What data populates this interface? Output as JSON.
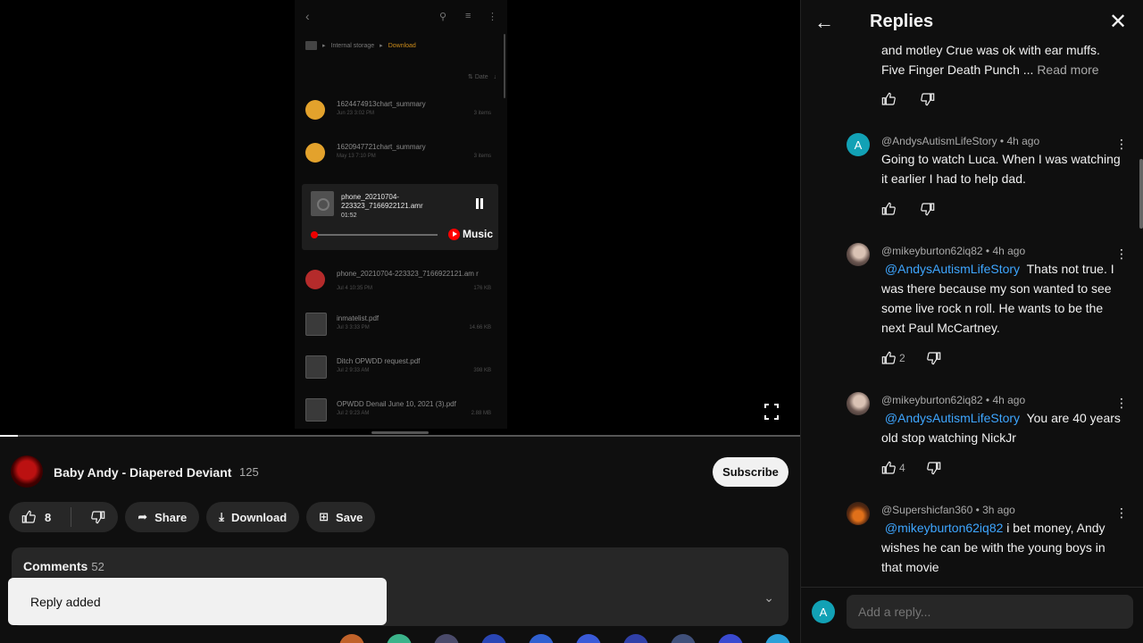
{
  "video": {
    "phone": {
      "crumb_root": "Internal storage",
      "crumb_current": "Download",
      "sort_label": "Date",
      "files": [
        {
          "name": "1624474913chart_summary",
          "sub": "Jun 23 3:02 PM",
          "right": "3 items"
        },
        {
          "name": "1620947721chart_summary",
          "sub": "May 13 7:10 PM",
          "right": "3 items"
        },
        {
          "name": "phone_20210704-223323_7166922121.am r",
          "sub": "Jul 4 10:35 PM",
          "right": "176 KB"
        },
        {
          "name": "inmatelist.pdf",
          "sub": "Jul 3 3:33 PM",
          "right": "14.66 KB"
        },
        {
          "name": "Ditch OPWDD request.pdf",
          "sub": "Jul 2 9:33 AM",
          "right": "398 KB"
        },
        {
          "name": "OPWDD Denail June 10, 2021 (3).pdf",
          "sub": "Jul 2 9:23 AM",
          "right": "2.88 MB"
        }
      ],
      "player": {
        "file_name": "phone_20210704-223323_7166922121.amr",
        "time": "01:52",
        "music_label": "Music",
        "progress": 0.02
      }
    }
  },
  "channel": {
    "name": "Baby Andy - Diapered Deviant",
    "subscribers": "125",
    "subscribe_label": "Subscribe"
  },
  "actions": {
    "likes": "8",
    "share": "Share",
    "download": "Download",
    "save": "Save"
  },
  "comments_section": {
    "label": "Comments",
    "count": "52"
  },
  "toast": "Reply added",
  "panel": {
    "title": "Replies",
    "comments": [
      {
        "handle": "",
        "time": "",
        "text": "and motley Crue was ok with ear muffs. Five Finger Death Punch ...",
        "read_more": "Read more",
        "likes": ""
      },
      {
        "avatar_letter": "A",
        "avatar_color": "#12a1b5",
        "handle": "@AndysAutismLifeStory",
        "time": "4h ago",
        "text": "Going to watch Luca. When I was watching it earlier I had to help dad.",
        "likes": ""
      },
      {
        "handle": "@mikeyburton62iq82",
        "time": "4h ago",
        "mention": "@AndysAutismLifeStory",
        "text": "Thats not true. I was there because my son wanted to see some live rock n roll. He wants to be the next Paul McCartney.",
        "likes": "2"
      },
      {
        "handle": "@mikeyburton62iq82",
        "time": "4h ago",
        "mention": "@AndysAutismLifeStory",
        "text": "You are 40 years old stop watching NickJr",
        "likes": "4"
      },
      {
        "handle": "@Supershicfan360",
        "time": "3h ago",
        "mention": "@mikeyburton62iq82",
        "text": "i bet money, Andy wishes he can be with the young boys in that movie",
        "likes": ""
      }
    ],
    "reply_placeholder": "Add a reply...",
    "my_avatar_letter": "A"
  }
}
